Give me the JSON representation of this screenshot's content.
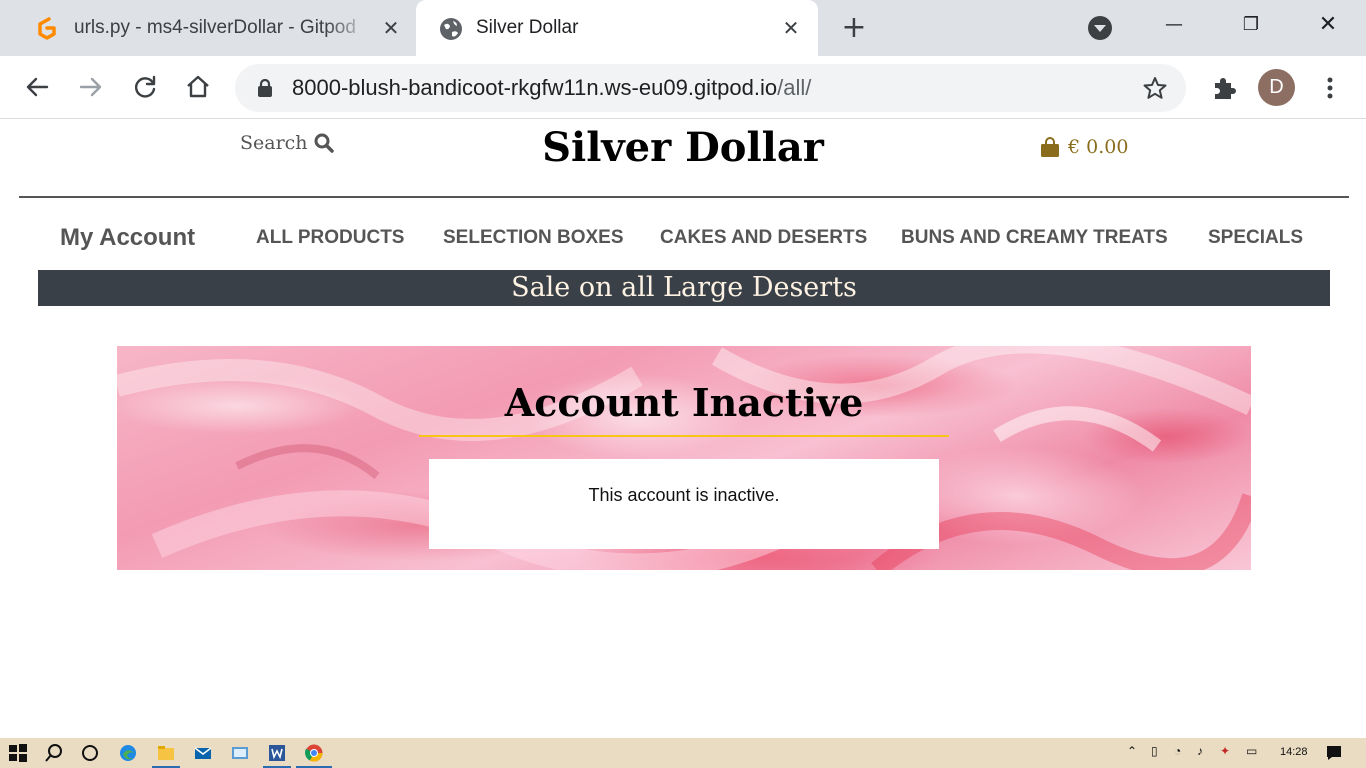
{
  "browser": {
    "tabs": [
      {
        "title": "urls.py - ms4-silverDollar - Gitpod",
        "icon": "gitpod-icon",
        "active": false
      },
      {
        "title": "Silver Dollar",
        "icon": "globe-icon",
        "active": true
      }
    ],
    "close_glyph": "✕",
    "new_tab_glyph": "+",
    "window_controls": {
      "minimize": "—",
      "maximize": "❐",
      "close": "✕"
    },
    "url_host": "8000-blush-bandicoot-rkgfw11n.ws-eu09.gitpod.io",
    "url_path": "/all/",
    "profile_initial": "D"
  },
  "site": {
    "search_label": "Search",
    "brand": "Silver Dollar",
    "cart_total": "€ 0.00",
    "nav": {
      "account": "My Account",
      "items": [
        "ALL PRODUCTS",
        "SELECTION BOXES",
        "CAKES AND DESERTS",
        "BUNS AND CREAMY TREATS",
        "SPECIALS"
      ]
    },
    "banner": "Sale on all Large Deserts",
    "page_title": "Account Inactive",
    "message": "This account is inactive."
  },
  "taskbar": {
    "clock": "14:28"
  },
  "colors": {
    "banner_bg": "#3a4048",
    "accent_rule": "#f5c518",
    "cart_gold": "#8a6d1c",
    "profile_bg": "#8d6e63"
  }
}
